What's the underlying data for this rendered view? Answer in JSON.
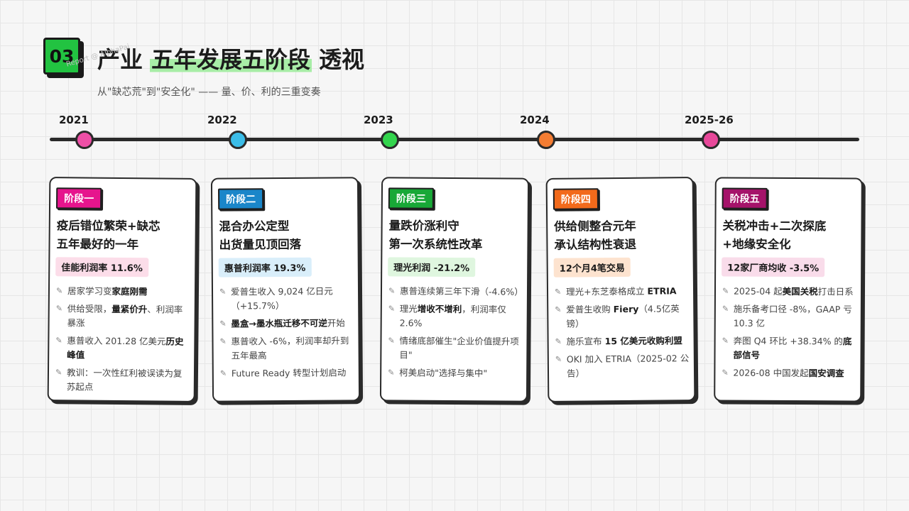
{
  "header": {
    "badge": "03",
    "title_pre": "产业",
    "title_highlight": "五年发展五阶段",
    "title_post": "透视",
    "watermark": "Report @ AlphaPai",
    "subtitle": "从\"缺芯荒\"到\"安全化\" —— 量、价、利的三重变奏"
  },
  "timeline": {
    "years": [
      "2021",
      "2022",
      "2023",
      "2024",
      "2025-26"
    ],
    "dot_colors": [
      "#ee4fa6",
      "#3bbde8",
      "#33d44d",
      "#f47d33",
      "#e8489a"
    ]
  },
  "cards": [
    {
      "tag": "阶段一",
      "tag_color": "#e6158d",
      "title_line1": "疫后错位繁荣+缺芯",
      "title_line2": "五年最好的一年",
      "metric": "佳能利润率 11.6%",
      "metric_bg": "#fcdde9",
      "items": [
        {
          "pre": "居家学习变",
          "bold": "家庭刚需",
          "post": ""
        },
        {
          "pre": "供给受限，",
          "bold": "量紧价升",
          "post": "、利润率暴涨"
        },
        {
          "pre": "惠普收入 201.28 亿美元",
          "bold": "历史峰值",
          "post": ""
        },
        {
          "pre": "教训：一次性红利被误读为复苏起点",
          "bold": "",
          "post": ""
        }
      ]
    },
    {
      "tag": "阶段二",
      "tag_color": "#1a86c9",
      "title_line1": "混合办公定型",
      "title_line2": "出货量见顶回落",
      "metric": "惠普利润率 19.3%",
      "metric_bg": "#d9eefa",
      "items": [
        {
          "pre": "爱普生收入 9,024 亿日元（+15.7%）",
          "bold": "",
          "post": ""
        },
        {
          "pre": "",
          "bold": "墨盒→墨水瓶迁移不可逆",
          "post": "开始"
        },
        {
          "pre": "惠普收入 -6%，利润率却升到五年最高",
          "bold": "",
          "post": ""
        },
        {
          "pre": "Future Ready 转型计划启动",
          "bold": "",
          "post": ""
        }
      ]
    },
    {
      "tag": "阶段三",
      "tag_color": "#18a837",
      "title_line1": "量跌价涨利守",
      "title_line2": "第一次系统性改革",
      "metric": "理光利润 -21.2%",
      "metric_bg": "#dff6df",
      "items": [
        {
          "pre": "惠普连续第三年下滑（-4.6%）",
          "bold": "",
          "post": ""
        },
        {
          "pre": "理光",
          "bold": "增收不增利",
          "post": "，利润率仅 2.6%"
        },
        {
          "pre": "情绪底部催生\"企业价值提升项目\"",
          "bold": "",
          "post": ""
        },
        {
          "pre": "柯美启动\"选择与集中\"",
          "bold": "",
          "post": ""
        }
      ]
    },
    {
      "tag": "阶段四",
      "tag_color": "#f26a1b",
      "title_line1": "供给侧整合元年",
      "title_line2": "承认结构性衰退",
      "metric": "12个月4笔交易",
      "metric_bg": "#fde3cf",
      "items": [
        {
          "pre": "理光+东芝泰格成立 ",
          "bold": "ETRIA",
          "post": ""
        },
        {
          "pre": "爱普生收购 ",
          "bold": "Fiery",
          "post": "（4.5亿英镑）"
        },
        {
          "pre": "施乐宣布 ",
          "bold": "15 亿美元收购利盟",
          "post": ""
        },
        {
          "pre": "OKI 加入 ETRIA（2025-02 公告）",
          "bold": "",
          "post": ""
        }
      ]
    },
    {
      "tag": "阶段五",
      "tag_color": "#a5136a",
      "title_line1": "关税冲击+二次探底",
      "title_line2": "+地缘安全化",
      "metric": "12家厂商均收 -3.5%",
      "metric_bg": "#f9dcea",
      "items": [
        {
          "pre": "2025-04 起",
          "bold": "美国关税",
          "post": "打击日系"
        },
        {
          "pre": "施乐备考口径 -8%，GAAP 亏 10.3 亿",
          "bold": "",
          "post": ""
        },
        {
          "pre": "奔图 Q4 环比 +38.34% 的",
          "bold": "底部信号",
          "post": ""
        },
        {
          "pre": "2026-08 中国发起",
          "bold": "国安调查",
          "post": ""
        }
      ]
    }
  ]
}
